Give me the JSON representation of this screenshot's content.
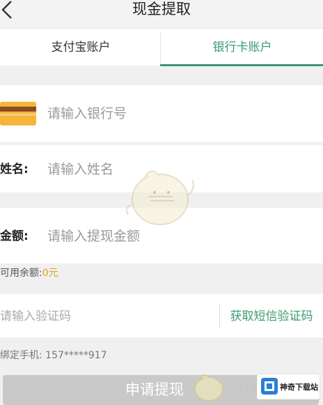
{
  "header": {
    "title": "现金提取",
    "back_icon": "chevron-left-icon"
  },
  "tabs": [
    {
      "label": "支付宝账户",
      "active": false
    },
    {
      "label": "银行卡账户",
      "active": true
    }
  ],
  "accent_color": "#3a9a70",
  "form": {
    "bank": {
      "icon": "bank-card-icon",
      "placeholder": "请输入银行号"
    },
    "name": {
      "label": "姓名:",
      "placeholder": "请输入姓名"
    },
    "amount": {
      "label": "金额:",
      "placeholder": "请输入提现金额"
    },
    "balance": {
      "label": "可用余额:",
      "value": "0元",
      "value_color": "#d9a51a"
    },
    "code": {
      "placeholder": "请输入验证码",
      "button": "获取短信验证码"
    },
    "phone": "绑定手机: 157*****917",
    "submit": "申请提现"
  },
  "watermark": {
    "mark": "3D",
    "badge_text": "神奇下载站"
  }
}
